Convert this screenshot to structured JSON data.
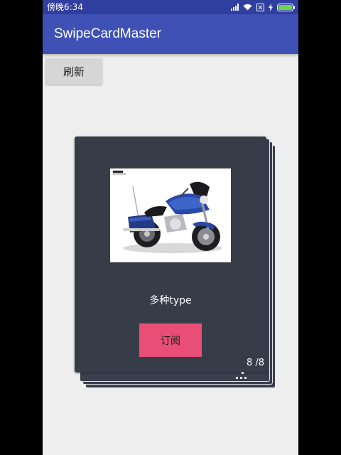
{
  "status_bar": {
    "time": "傍晚6:34",
    "icons": [
      "signal-icon",
      "wifi-icon",
      "sim-icon",
      "charging-icon",
      "battery-icon"
    ]
  },
  "app_bar": {
    "title": "SwipeCardMaster"
  },
  "toolbar": {
    "refresh_label": "刷新"
  },
  "card": {
    "image": "motorcycle-image",
    "caption": "多种type",
    "subscribe_label": "订阅",
    "counter": "8 /8"
  },
  "colors": {
    "status_bar": "#303f9f",
    "app_bar": "#3f51b5",
    "card_background": "#373c49",
    "subscribe_button": "#e94e77",
    "screen_background": "#eeeeee"
  }
}
